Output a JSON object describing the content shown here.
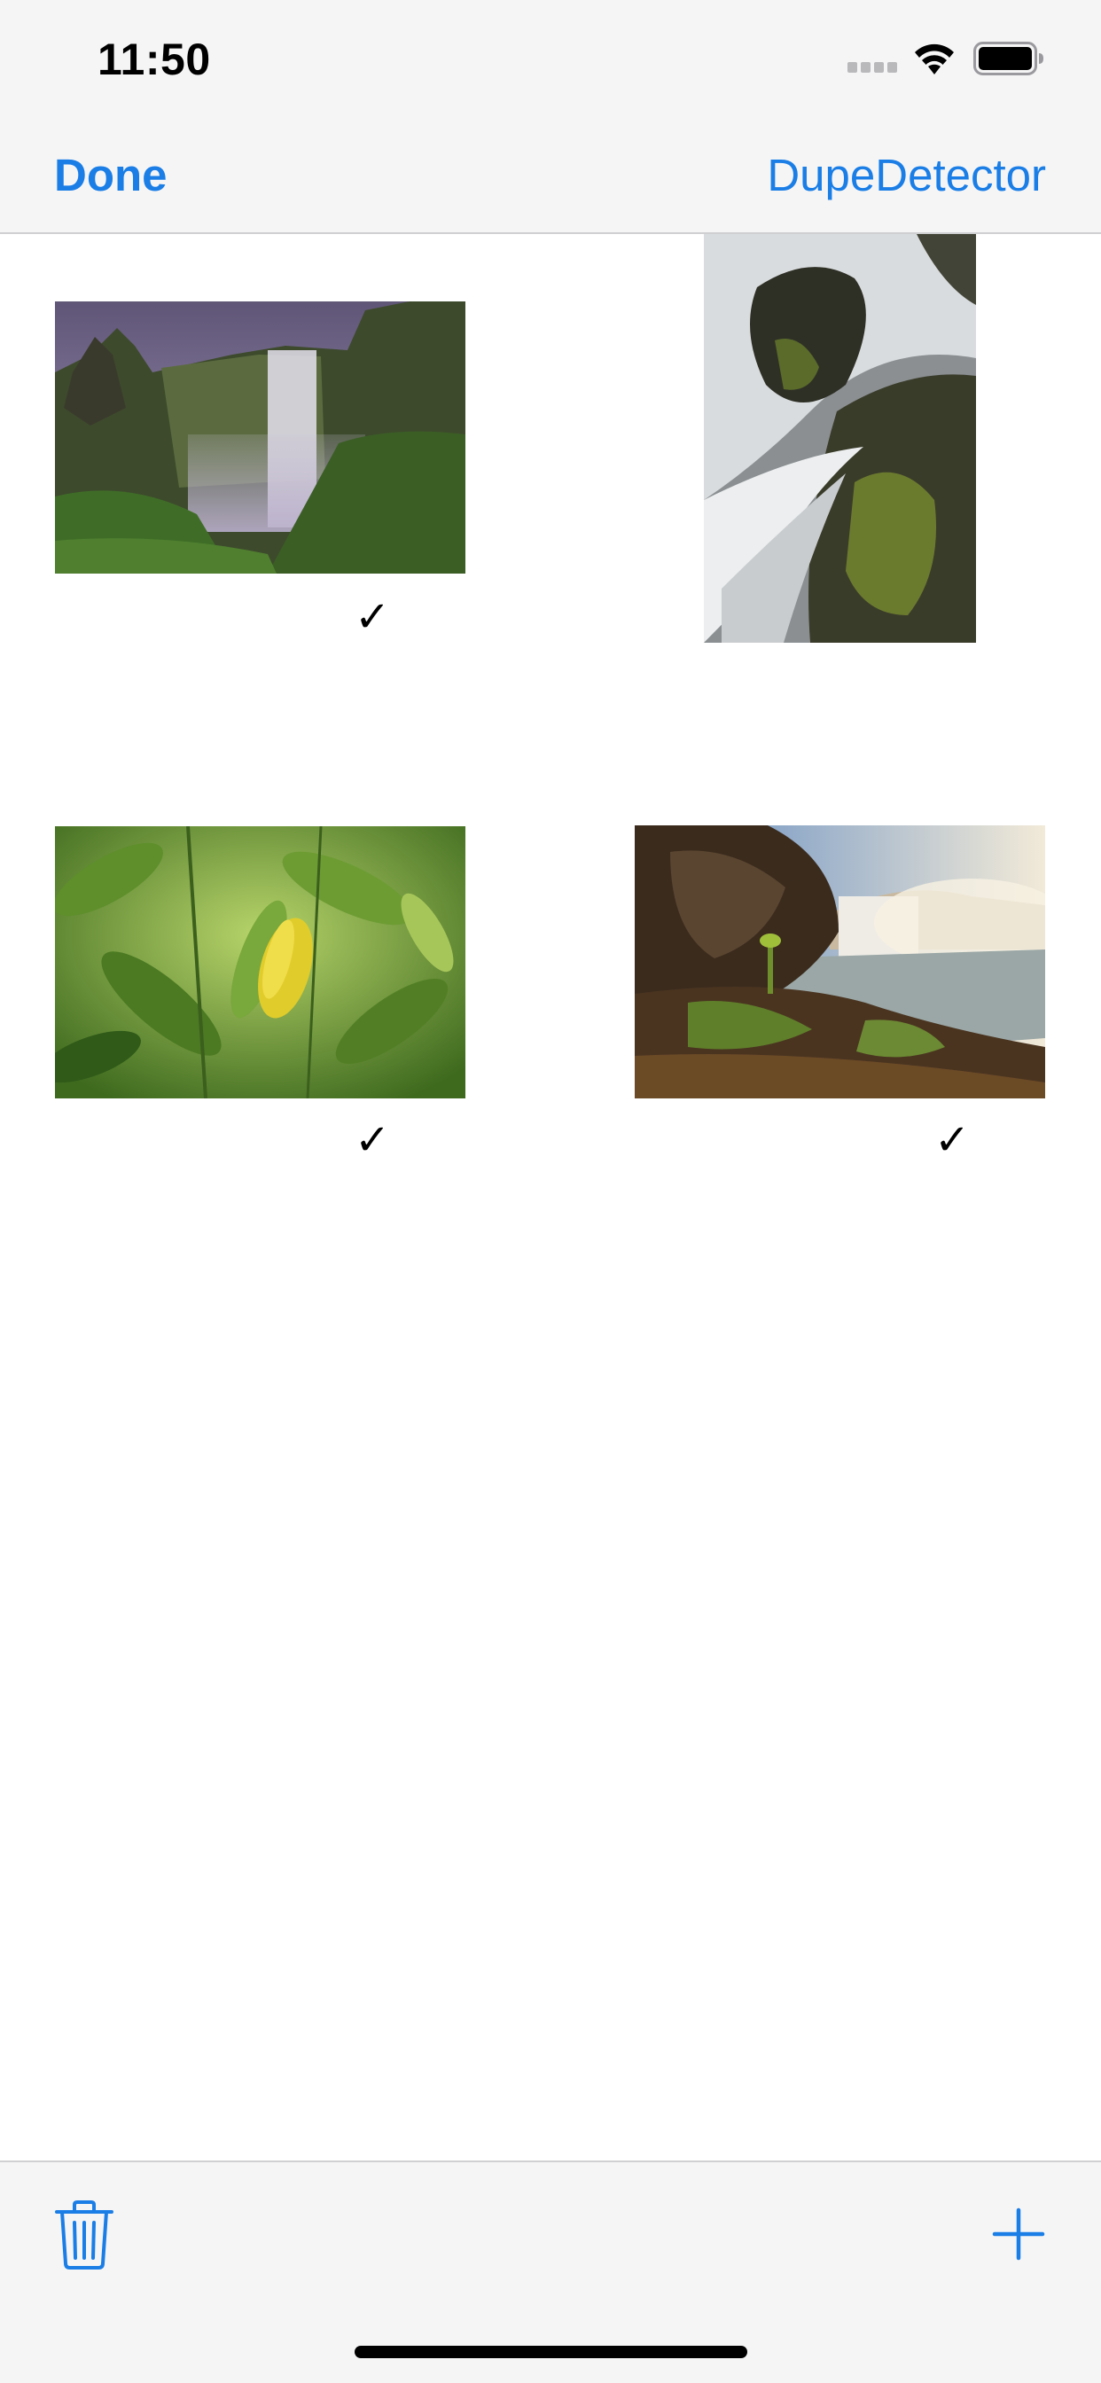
{
  "status_bar": {
    "time": "11:50",
    "icons": [
      "cellular-signal-icon",
      "wifi-icon",
      "battery-icon"
    ]
  },
  "nav": {
    "done_label": "Done",
    "title": "DupeDetector"
  },
  "photos": [
    {
      "name": "waterfall-valley-photo",
      "selected": true,
      "check": "✓"
    },
    {
      "name": "waterfall-rocks-photo",
      "selected": false,
      "check": ""
    },
    {
      "name": "green-leaves-photo",
      "selected": true,
      "check": "✓"
    },
    {
      "name": "waterfall-cliff-photo",
      "selected": true,
      "check": "✓"
    }
  ],
  "toolbar": {
    "icons": [
      "trash-icon",
      "plus-icon"
    ]
  },
  "colors": {
    "accent": "#1a7ee6",
    "bar_background": "#f5f5f6"
  }
}
